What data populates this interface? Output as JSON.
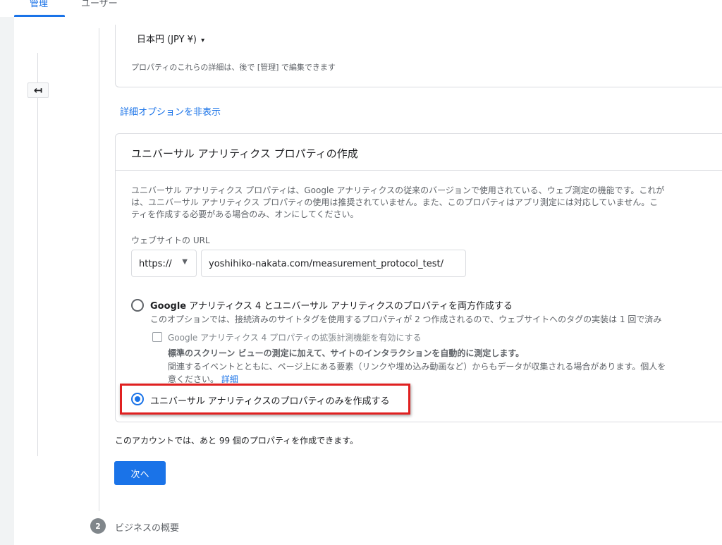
{
  "tabs": {
    "admin": "管理",
    "user": "ユーザー"
  },
  "property_details": {
    "currency": "日本円 (JPY ¥)",
    "currency_caret": "▾",
    "note": "プロパティのこれらの詳細は、後で [管理] で編集できます"
  },
  "advanced_options_link": "詳細オプションを非表示",
  "ua_section": {
    "title": "ユニバーサル アナリティクス プロパティの作成",
    "description_lines": [
      "ユニバーサル アナリティクス プロパティは、Google アナリティクスの従来のバージョンで使用されている、ウェブ測定の機能です。これが",
      "は、ユニバーサル アナリティクス プロパティの使用は推奨されていません。また、このプロパティはアプリ測定には対応していません。こ",
      "ティを作成する必要がある場合のみ、オンにしてください。"
    ],
    "url_label": "ウェブサイトの URL",
    "protocol": "https://",
    "url_value": "yoshihiko-nakata.com/measurement_protocol_test/",
    "option_both": {
      "label_bold": "Google",
      "label_rest": " アナリティクス 4 とユニバーサル アナリティクスのプロパティを両方作成する",
      "desc": "このオプションでは、接続済みのサイトタグを使用するプロパティが 2 つ作成されるので、ウェブサイトへのタグの実装は 1 回で済み"
    },
    "enhanced_measurement": {
      "label": "Google アナリティクス 4 プロパティの拡張計測機能を有効にする",
      "bold": "標準のスクリーン ビューの測定に加えて、サイトのインタラクションを自動的に測定します。",
      "desc_line1": "関連するイベントとともに、ページ上にある要素（リンクや埋め込み動画など）からもデータが収集される場合があります。個人を",
      "desc_line2": "意ください。",
      "detail_link": "詳細"
    },
    "option_ua_only": {
      "label": "ユニバーサル アナリティクスのプロパティのみを作成する",
      "selected": true
    }
  },
  "account_note": "このアカウントでは、あと 99 個のプロパティを作成できます。",
  "next_button": "次へ",
  "next_step": {
    "number": "2",
    "label": "ビジネスの概要"
  },
  "colors": {
    "accent": "#1a73e8",
    "highlight_border": "#e02020"
  }
}
